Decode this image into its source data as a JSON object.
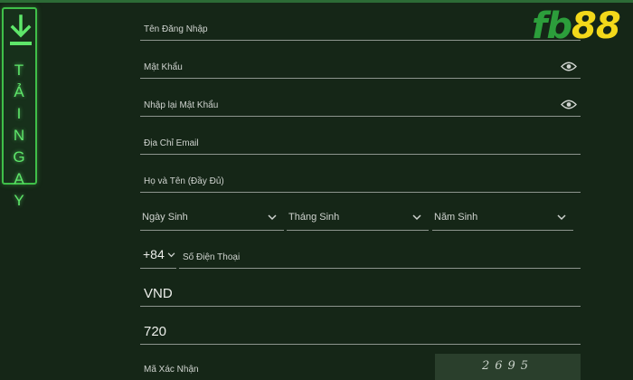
{
  "side_tab": {
    "icon": "download-icon",
    "letters": [
      "T",
      "Ả",
      "I",
      "N",
      "G",
      "A",
      "Y"
    ]
  },
  "logo": {
    "part1": "fb",
    "part2": "88"
  },
  "form": {
    "username": {
      "placeholder": "Tên Đăng Nhập"
    },
    "password": {
      "placeholder": "Mật Khẩu",
      "icon": "eye-icon"
    },
    "confirm_password": {
      "placeholder": "Nhập lại Mật Khẩu",
      "icon": "eye-icon"
    },
    "email": {
      "placeholder": "Địa Chỉ Email"
    },
    "full_name": {
      "placeholder": "Họ và Tên (Đầy Đủ)"
    },
    "birth_day": {
      "label": "Ngày Sinh",
      "icon": "chevron-down-icon"
    },
    "birth_month": {
      "label": "Tháng Sinh",
      "icon": "chevron-down-icon"
    },
    "birth_year": {
      "label": "Năm Sinh",
      "icon": "chevron-down-icon"
    },
    "phone_code": {
      "value": "+84",
      "icon": "chevron-down-icon"
    },
    "phone": {
      "placeholder": "Số Điện Thoại"
    },
    "currency": {
      "value": "VND"
    },
    "referral": {
      "value": "720"
    },
    "captcha": {
      "label": "Mã Xác Nhận",
      "code": "2695"
    }
  },
  "colors": {
    "background": "#152617",
    "accent_green": "#3fbf49",
    "logo_green": "#2c9e3b",
    "logo_yellow": "#f3d81a"
  }
}
